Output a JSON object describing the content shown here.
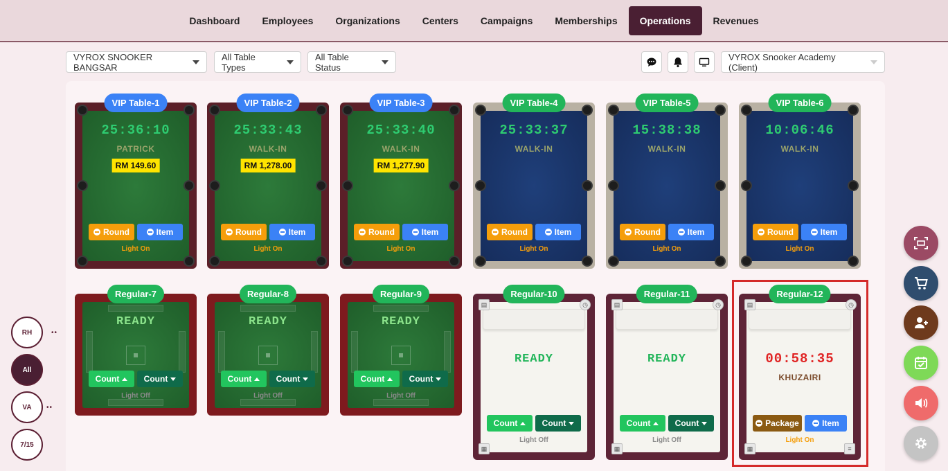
{
  "nav": {
    "items": [
      "Dashboard",
      "Employees",
      "Organizations",
      "Centers",
      "Campaigns",
      "Memberships",
      "Operations",
      "Revenues"
    ],
    "active": "Operations"
  },
  "filters": {
    "center": "VYROX SNOOKER BANGSAR",
    "table_types": "All Table Types",
    "table_status": "All Table Status",
    "client": "VYROX Snooker Academy (Client)"
  },
  "toolbar_icons": [
    "chat-icon",
    "bell-icon",
    "monitor-icon"
  ],
  "tables": {
    "vip1": {
      "name": "VIP Table-1",
      "timer": "25:36:10",
      "customer": "PATRICK",
      "price": "RM 149.60",
      "btn1": "Round",
      "btn2": "Item",
      "light": "Light On"
    },
    "vip2": {
      "name": "VIP Table-2",
      "timer": "25:33:43",
      "customer": "WALK-IN",
      "price": "RM 1,278.00",
      "btn1": "Round",
      "btn2": "Item",
      "light": "Light On"
    },
    "vip3": {
      "name": "VIP Table-3",
      "timer": "25:33:40",
      "customer": "WALK-IN",
      "price": "RM 1,277.90",
      "btn1": "Round",
      "btn2": "Item",
      "light": "Light On"
    },
    "vip4": {
      "name": "VIP Table-4",
      "timer": "25:33:37",
      "customer": "WALK-IN",
      "btn1": "Round",
      "btn2": "Item",
      "light": "Light On"
    },
    "vip5": {
      "name": "VIP Table-5",
      "timer": "15:38:38",
      "customer": "WALK-IN",
      "btn1": "Round",
      "btn2": "Item",
      "light": "Light On"
    },
    "vip6": {
      "name": "VIP Table-6",
      "timer": "10:06:46",
      "customer": "WALK-IN",
      "btn1": "Round",
      "btn2": "Item",
      "light": "Light On"
    },
    "reg7": {
      "name": "Regular-7",
      "status": "READY",
      "btn1": "Count",
      "btn2": "Count",
      "light": "Light Off"
    },
    "reg8": {
      "name": "Regular-8",
      "status": "READY",
      "btn1": "Count",
      "btn2": "Count",
      "light": "Light Off"
    },
    "reg9": {
      "name": "Regular-9",
      "status": "READY",
      "btn1": "Count",
      "btn2": "Count",
      "light": "Light Off"
    },
    "reg10": {
      "name": "Regular-10",
      "status": "READY",
      "btn1": "Count",
      "btn2": "Count",
      "light": "Light Off"
    },
    "reg11": {
      "name": "Regular-11",
      "status": "READY",
      "btn1": "Count",
      "btn2": "Count",
      "light": "Light Off"
    },
    "reg12": {
      "name": "Regular-12",
      "timer": "00:58:35",
      "customer": "KHUZAIRI",
      "btn1": "Package",
      "btn2": "Item",
      "light": "Light On"
    }
  },
  "left_filters": [
    "RH",
    "All",
    "VA",
    "7/15"
  ],
  "left_active": "All",
  "fabs": [
    {
      "icon": "scan-icon",
      "color": "#9b4a64"
    },
    {
      "icon": "cart-icon",
      "color": "#2f4d6e"
    },
    {
      "icon": "add-user-icon",
      "color": "#6e3a1d"
    },
    {
      "icon": "calendar-check-icon",
      "color": "#7ed957"
    },
    {
      "icon": "speaker-icon",
      "color": "#ef6b6b"
    },
    {
      "icon": "gear-icon",
      "color": "#c4c4c4"
    }
  ]
}
